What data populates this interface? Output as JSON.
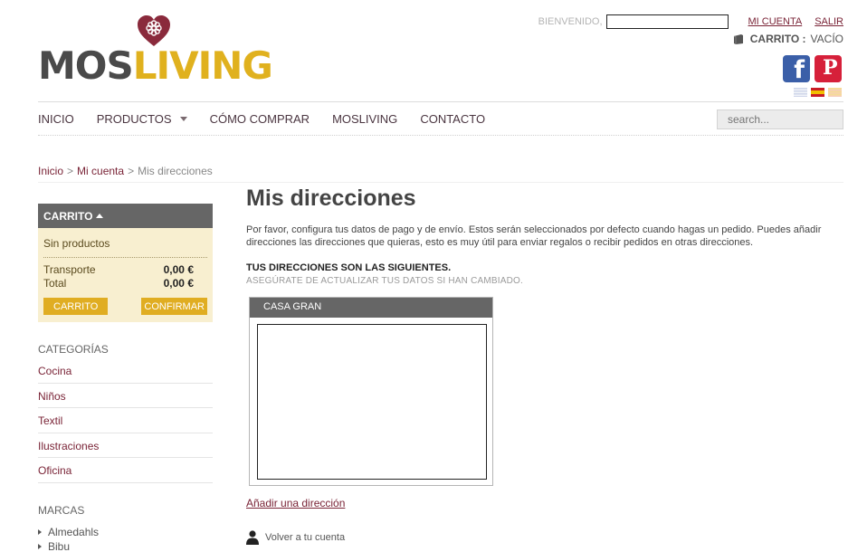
{
  "brand": {
    "word1": "MOS",
    "word2": "LIVING",
    "heart_color": "#8a2a3c",
    "accent": "#e0b11e"
  },
  "top_bar": {
    "welcome": "Bienvenido,",
    "my_account": "Mi cuenta",
    "logout": "Salir",
    "cart_label": "Carrito :",
    "cart_value": "Vacío"
  },
  "social": {
    "facebook_glyph": "f",
    "pinterest_glyph": "P"
  },
  "flags": [
    "english-flag-icon",
    "spanish-flag-icon",
    "catalan-flag-icon"
  ],
  "nav": {
    "items": [
      "Inicio",
      "Productos",
      "Cómo comprar",
      "Mosliving",
      "Contacto"
    ],
    "search_placeholder": "search..."
  },
  "breadcrumb": {
    "home": "Inicio",
    "account": "Mi cuenta",
    "current": "Mis direcciones",
    "separator": ">"
  },
  "cart": {
    "title": "Carrito",
    "empty": "Sin productos",
    "shipping_label": "Transporte",
    "shipping_value": "0,00 €",
    "total_label": "Total",
    "total_value": "0,00 €",
    "cart_button": "Carrito",
    "confirm_button": "Confirmar"
  },
  "categories": {
    "title": "Categorías",
    "items": [
      "Cocina",
      "Niños",
      "Textil",
      "Ilustraciones",
      "Oficina"
    ]
  },
  "brands": {
    "title": "Marcas",
    "items": [
      "Almedahls",
      "Bibu"
    ]
  },
  "main": {
    "title": "Mis direcciones",
    "intro": "Por favor, configura tus datos de pago y de envío. Estos serán seleccionados por defecto cuando hagas un pedido. Puedes añadir direcciones las direcciones que quieras, esto es muy útil para enviar regalos o recibir pedidos en otras direcciones.",
    "addresses_title": "Tus direcciones son las siguientes.",
    "addresses_note": "Asegúrate de actualizar tus datos si han cambiado.",
    "address_name": "Casa Gran",
    "add_address": "Añadir una dirección",
    "back_account": "Volver a tu cuenta"
  }
}
